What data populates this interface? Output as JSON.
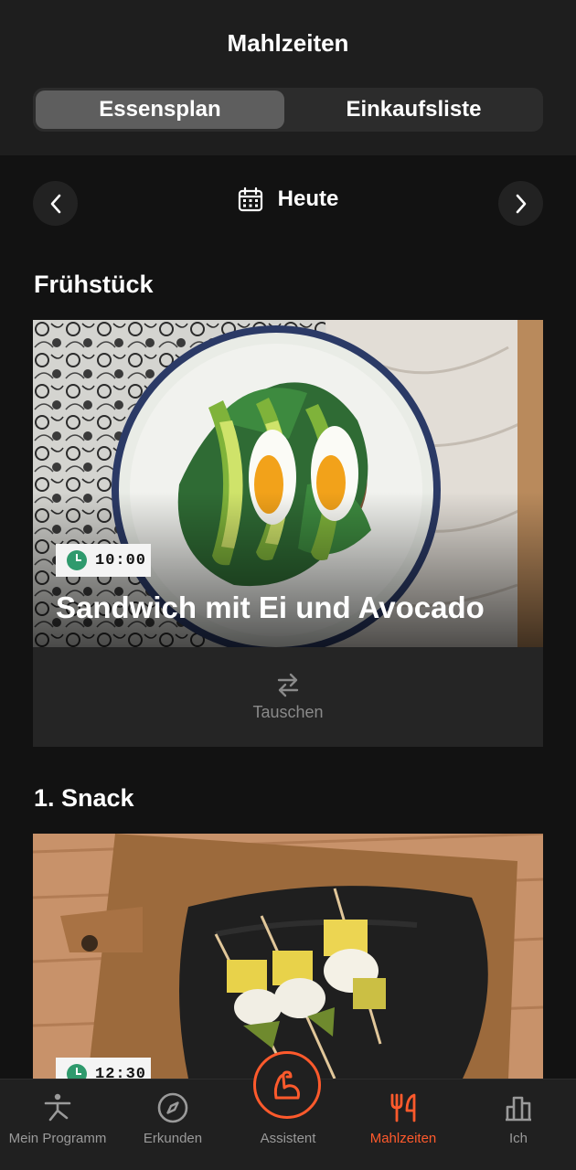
{
  "header": {
    "title": "Mahlzeiten",
    "tabs": [
      {
        "label": "Essensplan",
        "active": true
      },
      {
        "label": "Einkaufsliste",
        "active": false
      }
    ]
  },
  "date_nav": {
    "label": "Heute",
    "prev_icon": "chevron-left-icon",
    "next_icon": "chevron-right-icon",
    "calendar_icon": "calendar-icon"
  },
  "meals": [
    {
      "section": "Frühstück",
      "time": "10:00",
      "name": "Sandwich mit Ei und Avocado",
      "swap_label": "Tauschen"
    },
    {
      "section": "1. Snack",
      "time": "12:30"
    }
  ],
  "tabbar": {
    "items": [
      {
        "label": "Mein Programm",
        "icon": "stretching-figure-icon",
        "active": false
      },
      {
        "label": "Erkunden",
        "icon": "compass-icon",
        "active": false
      },
      {
        "label": "Assistent",
        "icon": "flexed-arm-icon",
        "active": false
      },
      {
        "label": "Mahlzeiten",
        "icon": "fork-knife-icon",
        "active": true
      },
      {
        "label": "Ich",
        "icon": "bar-chart-icon",
        "active": false
      }
    ]
  },
  "colors": {
    "accent": "#ff5a2c",
    "clock_green": "#2f9a6d",
    "background": "#121212"
  }
}
